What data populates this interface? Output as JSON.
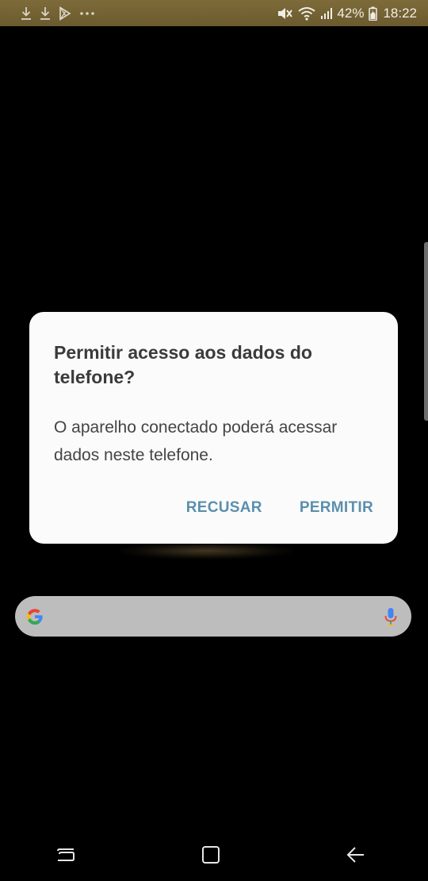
{
  "status_bar": {
    "left_icons": [
      "download-icon",
      "download-icon",
      "play-store-icon",
      "more-dots-icon"
    ],
    "right_icons": [
      "mute-icon",
      "wifi-icon",
      "signal-icon"
    ],
    "battery_percent": "42%",
    "battery_icon": "battery-icon",
    "time": "18:22"
  },
  "dialog": {
    "title": "Permitir acesso aos dados do telefone?",
    "message": "O aparelho conectado poderá acessar dados neste telefone.",
    "deny_label": "RECUSAR",
    "allow_label": "PERMITIR"
  },
  "search_bar": {
    "logo_icon": "google-logo-icon",
    "mic_icon": "microphone-icon"
  },
  "navigation_bar": {
    "recent_icon": "recent-apps-icon",
    "home_icon": "home-icon",
    "back_icon": "back-icon"
  },
  "colors": {
    "status_bar": "#6f5e31",
    "dialog_background": "#fbfbfb",
    "dialog_button": "#5b8fae",
    "search_bar": "#bdbdbd"
  }
}
